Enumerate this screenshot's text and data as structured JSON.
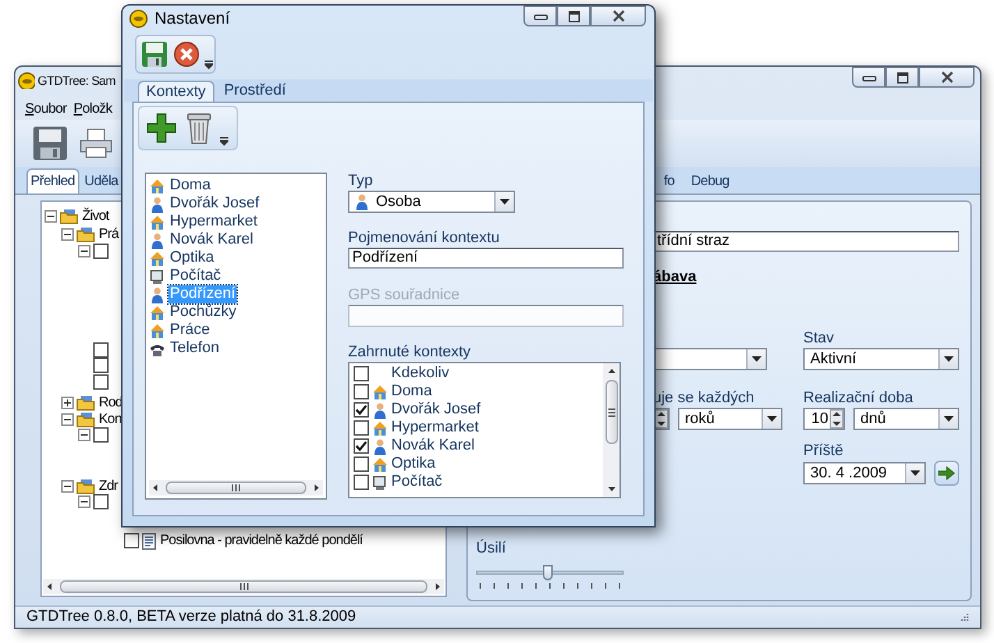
{
  "app_window": {
    "title": "GTDTree: Sam",
    "menu": [
      "Soubor",
      "Položk"
    ],
    "tabs": [
      {
        "label": "Přehled",
        "selected": true
      },
      {
        "label": "Uděla",
        "selected": false
      },
      {
        "label": "fo",
        "selected": false
      },
      {
        "label": "Debug",
        "selected": false
      }
    ],
    "tree": [
      {
        "label": "Život",
        "kind": "folder",
        "expanded": true,
        "children": [
          {
            "label": "Prá",
            "kind": "folder",
            "expanded": true,
            "children": [
              {
                "kind": "task",
                "checked": false,
                "expanded": true
              },
              {
                "kind": "task",
                "checked": false
              },
              {
                "kind": "task",
                "checked": false
              },
              {
                "kind": "task",
                "checked": false
              }
            ]
          },
          {
            "label": "Rod",
            "kind": "folder",
            "expanded": false
          },
          {
            "label": "Kon",
            "kind": "folder",
            "expanded": true,
            "children": [
              {
                "kind": "task",
                "checked": false,
                "expanded": true
              }
            ]
          },
          {
            "label": "Zdr",
            "kind": "folder",
            "expanded": true,
            "children": [
              {
                "kind": "task",
                "checked": false,
                "expanded": true,
                "children": [
                  {
                    "label": "Posilovna - pravidelně každé pondělí",
                    "kind": "note",
                    "checked": false
                  }
                ]
              }
            ]
          }
        ]
      }
    ],
    "detail": {
      "name_field": "třídní straz",
      "link": "ábava",
      "state": {
        "label": "Stav",
        "value": "Aktivní"
      },
      "repeat": {
        "label": "uje se každých",
        "unit": "roků"
      },
      "duration": {
        "label": "Realizační doba",
        "value": "10",
        "unit": "dnů"
      },
      "next": {
        "label": "Příště",
        "value": "30. 4 .2009"
      },
      "effort": {
        "label": "Úsilí",
        "level": 0.5
      }
    },
    "status_bar": "GTDTree 0.8.0, BETA verze platná do 31.8.2009"
  },
  "settings_dialog": {
    "title": "Nastavení",
    "tabs": [
      {
        "label": "Kontexty",
        "selected": true
      },
      {
        "label": "Prostředí",
        "selected": false
      }
    ],
    "contexts": [
      {
        "label": "Doma",
        "kind": "place",
        "selected": false
      },
      {
        "label": "Dvořák Josef",
        "kind": "person",
        "selected": false
      },
      {
        "label": "Hypermarket",
        "kind": "place",
        "selected": false
      },
      {
        "label": "Novák Karel",
        "kind": "person",
        "selected": false
      },
      {
        "label": "Optika",
        "kind": "place",
        "selected": false
      },
      {
        "label": "Počítač",
        "kind": "computer",
        "selected": false
      },
      {
        "label": "Podřízení",
        "kind": "person",
        "selected": true
      },
      {
        "label": "Pochůzky",
        "kind": "place",
        "selected": false
      },
      {
        "label": "Práce",
        "kind": "place",
        "selected": false
      },
      {
        "label": "Telefon",
        "kind": "phone",
        "selected": false
      }
    ],
    "type": {
      "label": "Typ",
      "value": "Osoba",
      "kind": "person"
    },
    "name": {
      "label": "Pojmenování kontextu",
      "value": "Podřízení"
    },
    "gps": {
      "label": "GPS souřadnice",
      "disabled": true
    },
    "included": {
      "label": "Zahrnuté kontexty",
      "items": [
        {
          "label": "Kdekoliv",
          "kind": "none",
          "checked": false
        },
        {
          "label": "Doma",
          "kind": "place",
          "checked": false
        },
        {
          "label": "Dvořák Josef",
          "kind": "person",
          "checked": true
        },
        {
          "label": "Hypermarket",
          "kind": "place",
          "checked": false
        },
        {
          "label": "Novák Karel",
          "kind": "person",
          "checked": true
        },
        {
          "label": "Optika",
          "kind": "place",
          "checked": false
        },
        {
          "label": "Počítač",
          "kind": "computer",
          "checked": false
        }
      ]
    }
  }
}
